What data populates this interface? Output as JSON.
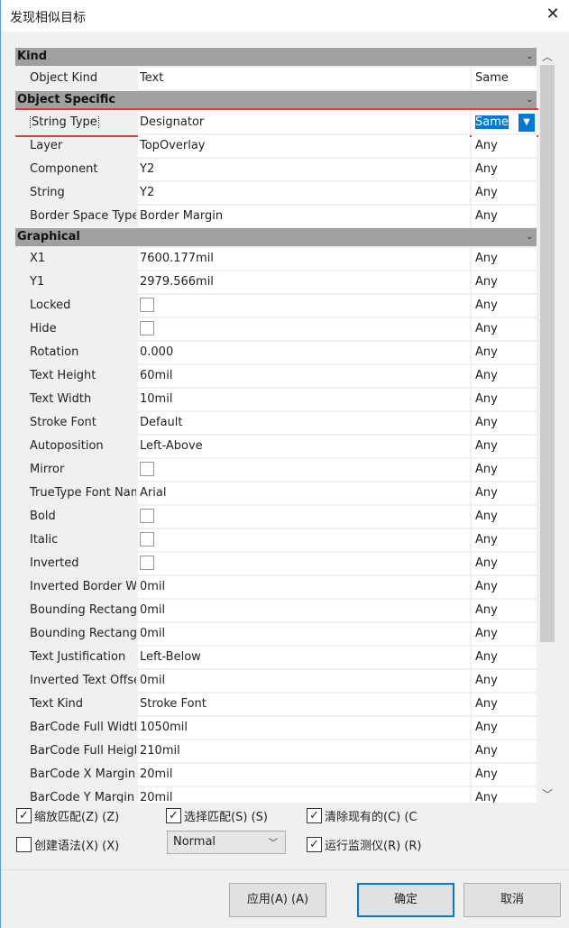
{
  "window": {
    "title": "发现相似目标",
    "close": "✕"
  },
  "sections": [
    {
      "title": "Kind",
      "rows": [
        {
          "label": "Object Kind",
          "value": "Text",
          "match": "Same"
        }
      ]
    },
    {
      "title": "Object Specific",
      "rows": [
        {
          "label": "String Type",
          "value": "Designator",
          "match": "Same",
          "selected": true
        },
        {
          "label": "Layer",
          "value": "TopOverlay",
          "match": "Any"
        },
        {
          "label": "Component",
          "value": "Y2",
          "match": "Any"
        },
        {
          "label": "String",
          "value": "Y2",
          "match": "Any"
        },
        {
          "label": "Border Space Type",
          "value": "Border Margin",
          "match": "Any"
        }
      ]
    },
    {
      "title": "Graphical",
      "rows": [
        {
          "label": "X1",
          "value": "7600.177mil",
          "match": "Any"
        },
        {
          "label": "Y1",
          "value": "2979.566mil",
          "match": "Any"
        },
        {
          "label": "Locked",
          "checkbox": false,
          "match": "Any"
        },
        {
          "label": "Hide",
          "checkbox": false,
          "match": "Any"
        },
        {
          "label": "Rotation",
          "value": "0.000",
          "match": "Any"
        },
        {
          "label": "Text Height",
          "value": "60mil",
          "match": "Any"
        },
        {
          "label": "Text Width",
          "value": "10mil",
          "match": "Any"
        },
        {
          "label": "Stroke Font",
          "value": "Default",
          "match": "Any"
        },
        {
          "label": "Autoposition",
          "value": "Left-Above",
          "match": "Any"
        },
        {
          "label": "Mirror",
          "checkbox": false,
          "match": "Any"
        },
        {
          "label": "TrueType Font Nam",
          "value": "Arial",
          "match": "Any"
        },
        {
          "label": "Bold",
          "checkbox": false,
          "match": "Any"
        },
        {
          "label": "Italic",
          "checkbox": false,
          "match": "Any"
        },
        {
          "label": "Inverted",
          "checkbox": false,
          "match": "Any"
        },
        {
          "label": "Inverted Border Wi",
          "value": "0mil",
          "match": "Any"
        },
        {
          "label": "Bounding Rectangl",
          "value": "0mil",
          "match": "Any"
        },
        {
          "label": "Bounding Rectangl",
          "value": "0mil",
          "match": "Any"
        },
        {
          "label": "Text Justification",
          "value": "Left-Below",
          "match": "Any"
        },
        {
          "label": "Inverted Text Offse",
          "value": "0mil",
          "match": "Any"
        },
        {
          "label": "Text Kind",
          "value": "Stroke Font",
          "match": "Any"
        },
        {
          "label": "BarCode Full Width",
          "value": "1050mil",
          "match": "Any"
        },
        {
          "label": "BarCode Full Heigh",
          "value": "210mil",
          "match": "Any"
        },
        {
          "label": "BarCode X Margin",
          "value": "20mil",
          "match": "Any"
        },
        {
          "label": "BarCode Y Margin",
          "value": "20mil",
          "match": "Any"
        }
      ]
    }
  ],
  "options": {
    "zoom": {
      "label": "缩放匹配(Z) (Z)",
      "checked": true
    },
    "select": {
      "label": "选择匹配(S) (S)",
      "checked": true
    },
    "clear": {
      "label": "清除现有的(C) (C",
      "checked": true
    },
    "create": {
      "label": "创建语法(X) (X)",
      "checked": false
    },
    "mode": "Normal",
    "monitor": {
      "label": "运行监测仪(R) (R)",
      "checked": true
    }
  },
  "buttons": {
    "apply": "应用(A) (A)",
    "ok": "确定",
    "cancel": "取消"
  },
  "colors": {
    "header": "#a0a0a0",
    "highlight": "#e03c3c",
    "accent": "#0078d7"
  }
}
